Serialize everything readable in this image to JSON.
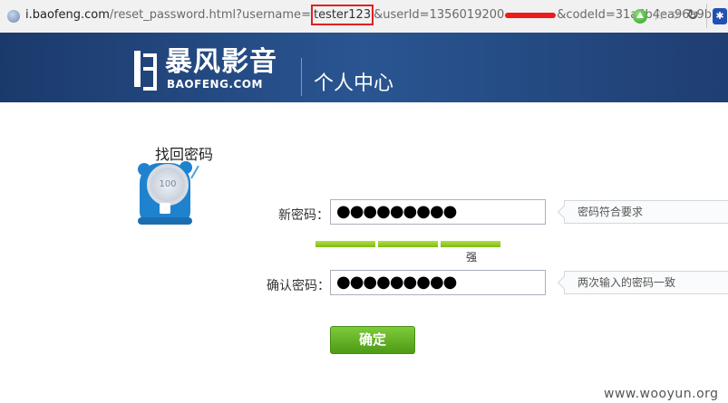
{
  "address_bar": {
    "url_host": "i.baofeng.com",
    "url_path": "/reset_password.html?username",
    "url_eq": "=",
    "url_highlight": "tester123",
    "url_mid": "&userId=1356019200",
    "url_tail": "&codeId=31a5b4ea96a9b",
    "icons": [
      "globe-icon",
      "go-icon",
      "star-icon",
      "dropdown-icon",
      "reload-icon",
      "baidu-icon"
    ]
  },
  "header": {
    "logo_cn": "暴风影音",
    "logo_en": "BAOFENG.COM",
    "title": "个人中心"
  },
  "section": {
    "title": "找回密码",
    "mascot_text": "100"
  },
  "form": {
    "new_password_label": "新密码：",
    "new_password_value": "●●●●●●●●●",
    "new_password_tip": "密码符合要求",
    "strength_label": "强",
    "strength_level": 3,
    "strength_max": 3,
    "confirm_password_label": "确认密码：",
    "confirm_password_value": "●●●●●●●●●",
    "confirm_password_tip": "两次输入的密码一致",
    "submit_label": "确定"
  },
  "watermark": "www.wooyun.org",
  "colors": {
    "banner": "#2a5591",
    "button": "#5ea823",
    "highlight_box": "#e02020",
    "strength": "#8cc21c"
  }
}
